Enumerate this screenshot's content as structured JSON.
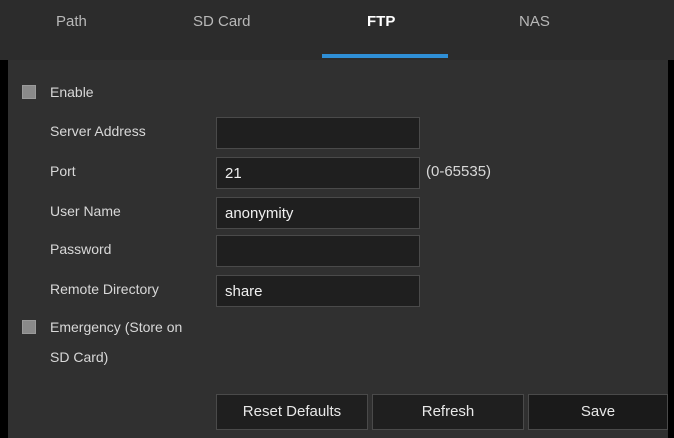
{
  "tabs": [
    {
      "label": "Path"
    },
    {
      "label": "SD Card"
    },
    {
      "label": "FTP",
      "active": true
    },
    {
      "label": "NAS"
    }
  ],
  "form": {
    "enable_label": "Enable",
    "server_address_label": "Server Address",
    "server_address_value": "",
    "port_label": "Port",
    "port_value": "21",
    "port_range": "(0-65535)",
    "user_name_label": "User Name",
    "user_name_value": "anonymity",
    "password_label": "Password",
    "password_value": "",
    "remote_directory_label": "Remote Directory",
    "remote_directory_value": "share",
    "emergency_label_line1": "Emergency (Store on",
    "emergency_label_line2": "SD Card)"
  },
  "buttons": {
    "reset_defaults": "Reset Defaults",
    "refresh": "Refresh",
    "save": "Save"
  },
  "colors": {
    "accent": "#2f8fd6",
    "panel": "#303030",
    "tabbar": "#2c2c2c"
  }
}
